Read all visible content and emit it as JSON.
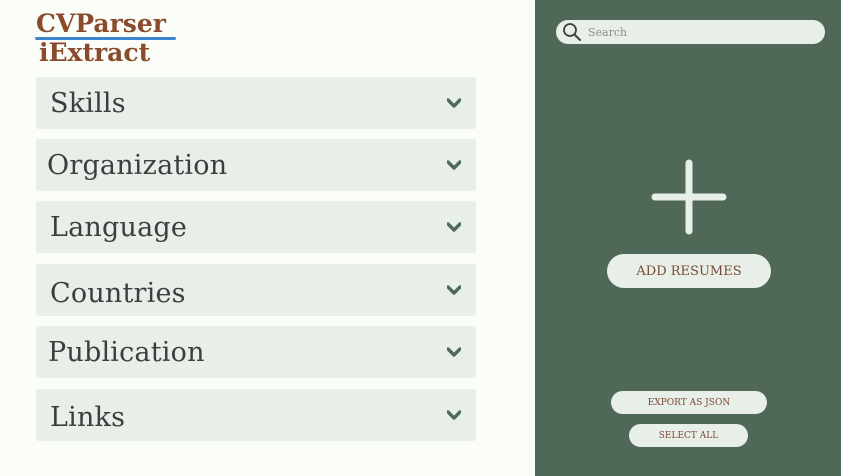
{
  "brand": {
    "line1": "CVParser",
    "line2": "iExtract",
    "color": "#8a4b2c",
    "underline_color": "#3b86cf"
  },
  "filters": [
    {
      "label": "Skills",
      "icon": "chevron-down-icon"
    },
    {
      "label": "Organization",
      "icon": "chevron-down-icon"
    },
    {
      "label": "Language",
      "icon": "chevron-down-icon"
    },
    {
      "label": "Countries",
      "icon": "chevron-down-icon"
    },
    {
      "label": "Publication",
      "icon": "chevron-down-icon"
    },
    {
      "label": "Links",
      "icon": "chevron-down-icon"
    }
  ],
  "panel": {
    "background": "#506858",
    "search": {
      "placeholder": "Search",
      "icon": "search-icon"
    },
    "add_icon": "plus-icon",
    "add_button": "ADD RESUMES",
    "export_button": "EXPORT AS JSON",
    "select_all_button": "SELECT ALL"
  }
}
